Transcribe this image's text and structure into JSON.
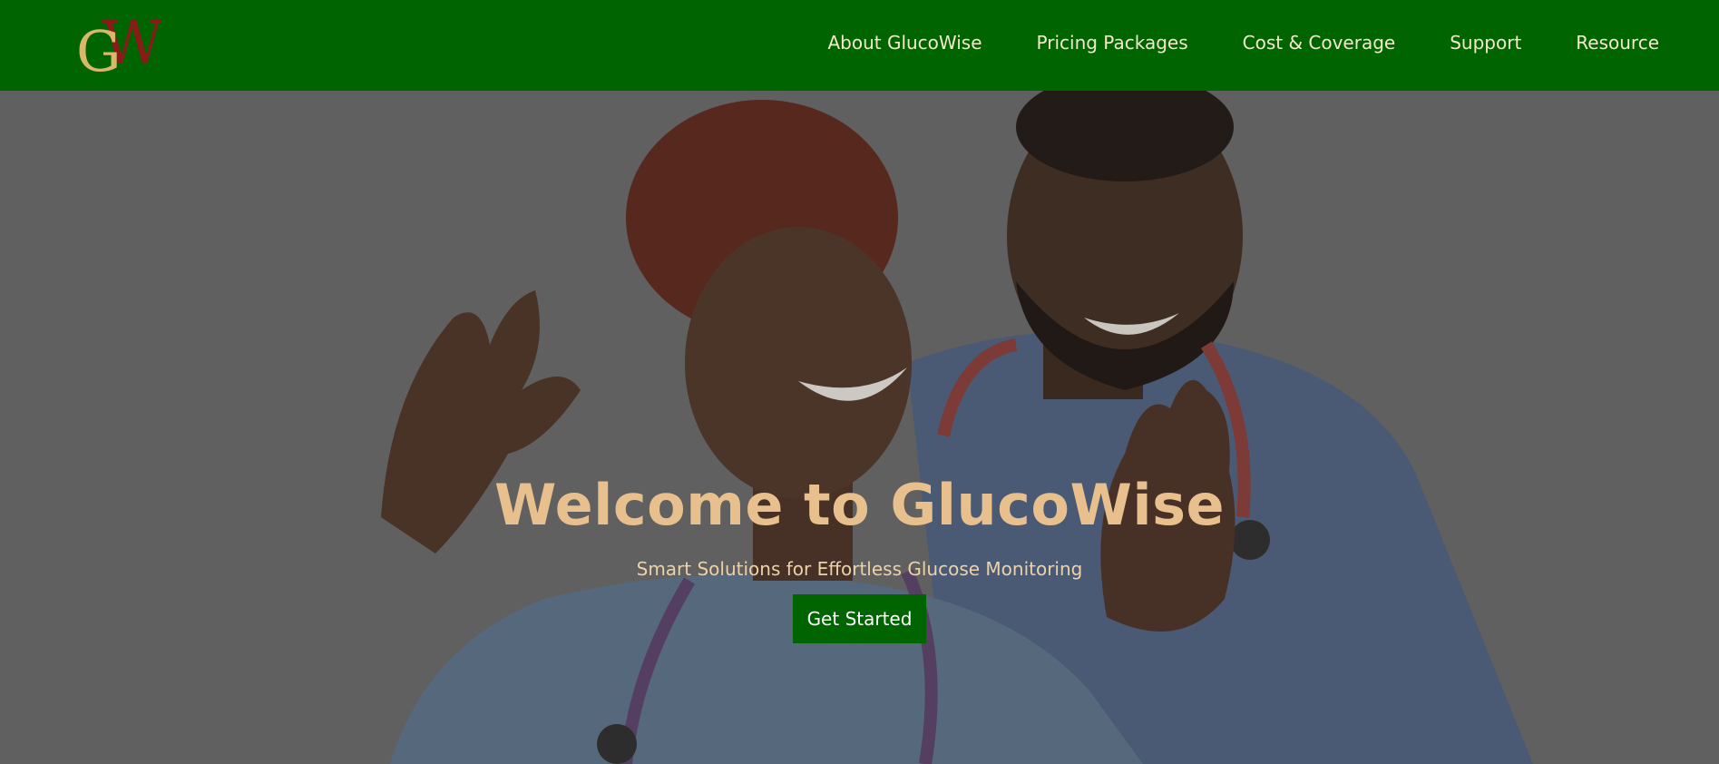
{
  "brand": {
    "logo_letters": "GW",
    "name": "GlucoWise"
  },
  "nav": {
    "items": [
      {
        "label": "About GlucoWise"
      },
      {
        "label": "Pricing Packages"
      },
      {
        "label": "Cost & Coverage"
      },
      {
        "label": "Support"
      },
      {
        "label": "Resource"
      }
    ]
  },
  "hero": {
    "title": "Welcome to GlucoWise",
    "subtitle": "Smart Solutions for Effortless Glucose Monitoring",
    "cta_label": "Get Started",
    "image_description_icon": "healthcare-workers-photo"
  },
  "colors": {
    "nav_bg": "#006400",
    "nav_text": "#f4e8cc",
    "title": "#e7c08d",
    "subtitle": "#ecd2a8",
    "cta_bg": "#006400",
    "logo_gold": "#d9b86a",
    "logo_red": "#8b1a1a"
  }
}
